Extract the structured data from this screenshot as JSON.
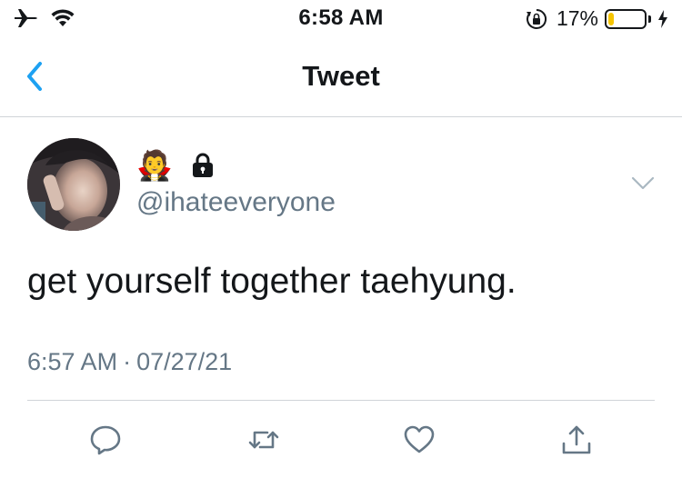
{
  "status_bar": {
    "time": "6:58 AM",
    "battery_percent": "17%",
    "battery_level": 0.17,
    "icons": [
      "airplane-icon",
      "wifi-icon",
      "rotation-lock-icon",
      "battery-icon",
      "charging-bolt-icon"
    ]
  },
  "nav": {
    "title": "Tweet",
    "back_icon": "chevron-left-icon"
  },
  "tweet": {
    "display_name": "🧛",
    "protected": true,
    "handle": "@ihateeveryone",
    "text": "get yourself together taehyung.",
    "time": "6:57 AM",
    "separator": "·",
    "date": "07/27/21"
  },
  "actions": [
    "reply-icon",
    "retweet-icon",
    "like-icon",
    "share-icon"
  ],
  "colors": {
    "accent": "#1da1f2",
    "text": "#14171a",
    "secondary_text": "#657786",
    "divider": "#d0d4d8",
    "battery_fill": "#f5c400"
  }
}
